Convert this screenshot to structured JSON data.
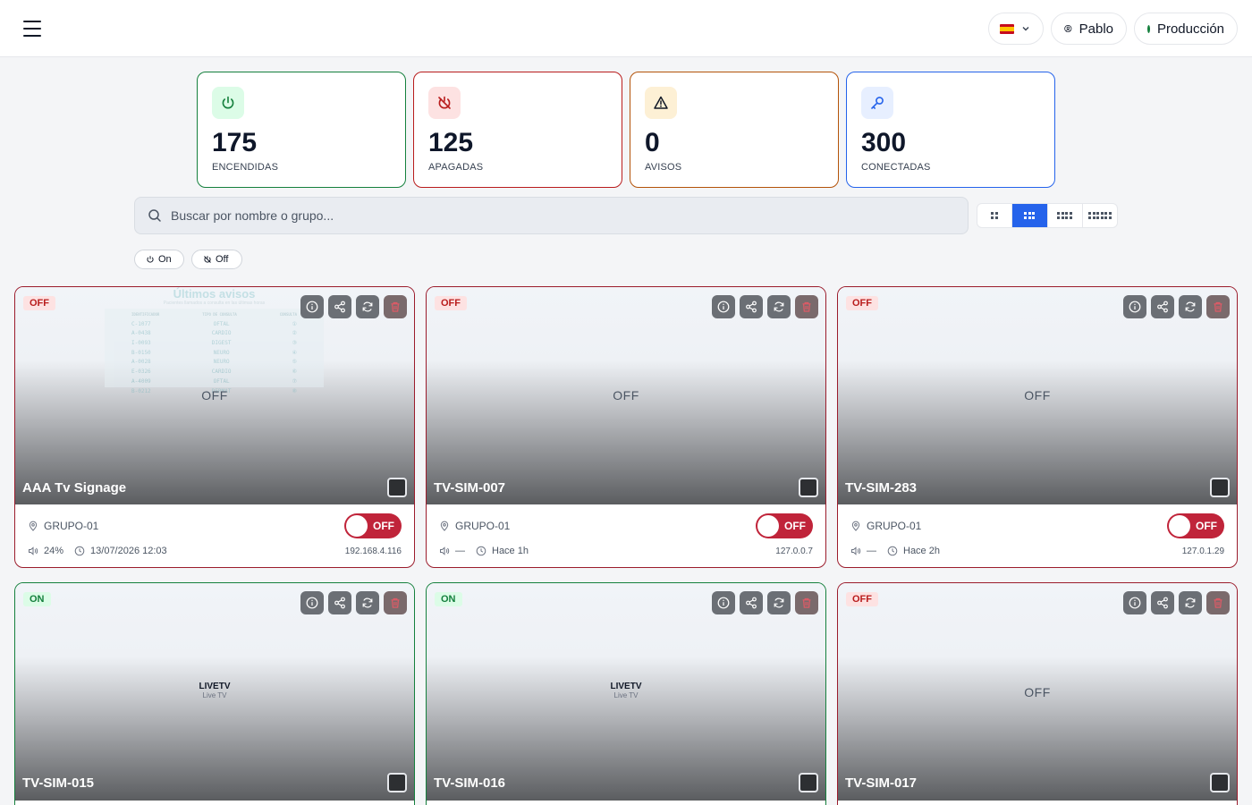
{
  "header": {
    "language_code": "es",
    "user_label": "Pablo",
    "environment_label": "Producción",
    "environment_color": "#15803d"
  },
  "stats": [
    {
      "value": "175",
      "label": "ENCENDIDAS",
      "icon": "power-icon",
      "color": "#15803d"
    },
    {
      "value": "125",
      "label": "APAGADAS",
      "icon": "power-off-icon",
      "color": "#b91c1c"
    },
    {
      "value": "0",
      "label": "AVISOS",
      "icon": "warning-icon",
      "color": "#b45309"
    },
    {
      "value": "300",
      "label": "CONECTADAS",
      "icon": "key-icon",
      "color": "#2563eb"
    }
  ],
  "search": {
    "placeholder": "Buscar por nombre o grupo..."
  },
  "view_modes": {
    "selected": 1,
    "options": [
      "grid-2x2",
      "grid-3",
      "grid-4",
      "grid-6"
    ]
  },
  "filters": [
    {
      "label": "On"
    },
    {
      "label": "Off"
    }
  ],
  "devices": [
    {
      "status": "OFF",
      "name": "AAA Tv Signage",
      "group": "GRUPO-01",
      "volume": "24%",
      "time": "13/07/2026 12:03",
      "ip": "192.168.4.116",
      "screen_text": "OFF",
      "toggle": "OFF",
      "thumbnail": {
        "title": "Últimos avisos",
        "subtitle": "Pacientes llamados a consulta en las últimas horas",
        "columns": [
          "IDENTIFICADOR",
          "TIPO DE CONSULTA",
          "CONSULTA"
        ],
        "rows": [
          [
            "C-1077",
            "OFTAL",
            "①"
          ],
          [
            "A-0438",
            "CARDIO",
            "②"
          ],
          [
            "I-0093",
            "DIGEST",
            "③"
          ],
          [
            "B-0150",
            "NEURO",
            "④"
          ],
          [
            "A-0028",
            "NEURO",
            "⑤"
          ],
          [
            "E-0326",
            "CARDIO",
            "⑥"
          ],
          [
            "A-4009",
            "OFTAL",
            "⑦"
          ],
          [
            "B-0212",
            "DERMAT",
            "⑧"
          ]
        ]
      }
    },
    {
      "status": "OFF",
      "name": "TV-SIM-007",
      "group": "GRUPO-01",
      "volume": "—",
      "time": "Hace 1h",
      "ip": "127.0.0.7",
      "screen_text": "OFF",
      "toggle": "OFF"
    },
    {
      "status": "OFF",
      "name": "TV-SIM-283",
      "group": "GRUPO-01",
      "volume": "—",
      "time": "Hace 2h",
      "ip": "127.0.1.29",
      "screen_text": "OFF",
      "toggle": "OFF"
    },
    {
      "status": "ON",
      "name": "TV-SIM-015",
      "screen_title": "LIVETV",
      "screen_subtitle": "Live TV"
    },
    {
      "status": "ON",
      "name": "TV-SIM-016",
      "screen_title": "LIVETV",
      "screen_subtitle": "Live TV"
    },
    {
      "status": "OFF",
      "name": "TV-SIM-017",
      "screen_text": "OFF"
    }
  ]
}
